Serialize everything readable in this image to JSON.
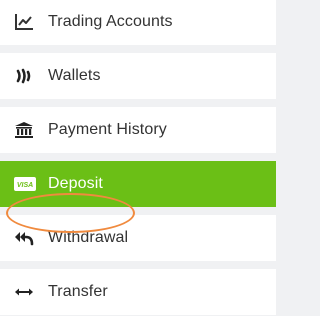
{
  "menu": {
    "items": [
      {
        "label": "Trading Accounts",
        "icon": "chart-line-icon"
      },
      {
        "label": "Wallets",
        "icon": "wallet-icon"
      },
      {
        "label": "Payment History",
        "icon": "bank-icon"
      },
      {
        "label": "Deposit",
        "icon": "visa-card-icon",
        "active": true
      },
      {
        "label": "Withdrawal",
        "icon": "reply-all-icon",
        "highlighted": true
      },
      {
        "label": "Transfer",
        "icon": "arrows-horizontal-icon"
      }
    ]
  },
  "colors": {
    "active_background": "#6bbf16",
    "highlight_ring": "#f08a3e",
    "item_background": "#ffffff",
    "page_background": "#f0f1f3",
    "text": "#333333"
  }
}
